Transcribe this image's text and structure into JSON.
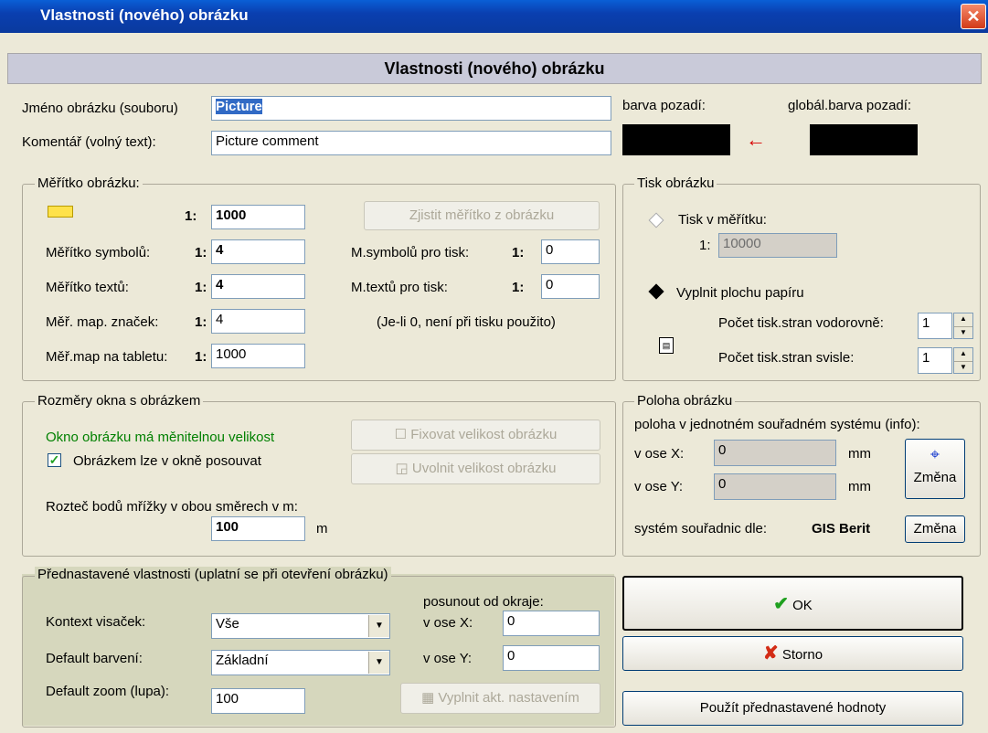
{
  "window": {
    "title": "Vlastnosti (nového) obrázku",
    "close": "✕"
  },
  "header": {
    "title": "Vlastnosti (nového) obrázku"
  },
  "name": {
    "label": "Jméno obrázku (souboru)",
    "value": "Picture"
  },
  "comment": {
    "label": "Komentář (volný text):",
    "value": "Picture comment"
  },
  "colors": {
    "bg_label": "barva pozadí:",
    "global_label": "globál.barva pozadí:",
    "bg": "#000000",
    "global": "#000000"
  },
  "scale": {
    "group": "Měřítko obrázku:",
    "prefix": "1:",
    "main_value": "1000",
    "detect_button": "Zjistit měřítko z obrázku",
    "symbols_label": "Měřítko symbolů:",
    "symbols_value": "4",
    "texts_label": "Měřítko textů:",
    "texts_value": "4",
    "mapsigns_label": "Měř. map. značek:",
    "mapsigns_value": "4",
    "tablet_label": "Měř.map na tabletu:",
    "tablet_value": "1000",
    "print_symbols_label": "M.symbolů pro tisk:",
    "print_symbols_value": "0",
    "print_texts_label": "M.textů pro tisk:",
    "print_texts_value": "0",
    "note": "(Je-li 0, není při tisku použito)"
  },
  "print": {
    "group": "Tisk obrázku",
    "scale_radio": "Tisk v měřítku:",
    "scale_prefix": "1:",
    "scale_value": "10000",
    "fill_radio": "Vyplnit plochu papíru",
    "horiz_label": "Počet tisk.stran vodorovně:",
    "horiz_value": "1",
    "vert_label": "Počet tisk.stran svisle:",
    "vert_value": "1"
  },
  "window_size": {
    "group": "Rozměry okna s obrázkem",
    "status": "Okno obrázku má měnitelnou velikost",
    "scroll_checkbox": "Obrázkem lze v okně posouvat",
    "fix_button": "Fixovat velikost obrázku",
    "release_button": "Uvolnit velikost obrázku",
    "grid_label": "Rozteč bodů mřížky v obou směrech v m:",
    "grid_value": "100",
    "grid_unit": "m"
  },
  "position": {
    "group": "Poloha obrázku",
    "info": "poloha v jednotném souřadném systému (info):",
    "x_label": "v ose X:",
    "x_value": "0",
    "y_label": "v ose Y:",
    "y_value": "0",
    "unit": "mm",
    "change_button": "Změna",
    "system_label": "systém souřadnic dle:",
    "system_value": "GIS Berit",
    "system_change_button": "Změna"
  },
  "presets": {
    "group": "Přednastavené vlastnosti (uplatní se při otevření obrázku)",
    "context_label": "Kontext visaček:",
    "context_value": "Vše",
    "color_label": "Default barvení:",
    "color_value": "Základní",
    "zoom_label": "Default zoom (lupa):",
    "zoom_value": "100",
    "offset_label": "posunout od okraje:",
    "offx_label": "v ose X:",
    "offx_value": "0",
    "offy_label": "v ose Y:",
    "offy_value": "0",
    "fill_button": "Vyplnit akt. nastavením"
  },
  "actions": {
    "ok": "OK",
    "cancel": "Storno",
    "apply_presets": "Použít přednastavené hodnoty"
  }
}
